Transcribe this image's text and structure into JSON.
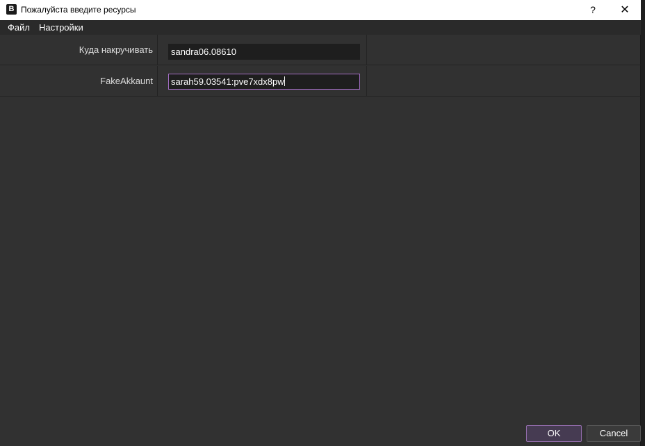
{
  "window": {
    "title": "Пожалуйста введите ресурсы",
    "icon_letter": "B",
    "help_glyph": "?",
    "close_glyph": "✕"
  },
  "menu": {
    "items": [
      "Файл",
      "Настройки"
    ]
  },
  "form": {
    "rows": [
      {
        "label": "Куда накручивать",
        "value": "sandra06.08610",
        "focused": false
      },
      {
        "label": "FakeAkkaunt",
        "value": "sarah59.03541:pve7xdx8pw",
        "focused": true
      }
    ]
  },
  "buttons": {
    "ok_label": "OK",
    "cancel_label": "Cancel"
  },
  "colors": {
    "background": "#313131",
    "accent": "#a46ec5"
  }
}
